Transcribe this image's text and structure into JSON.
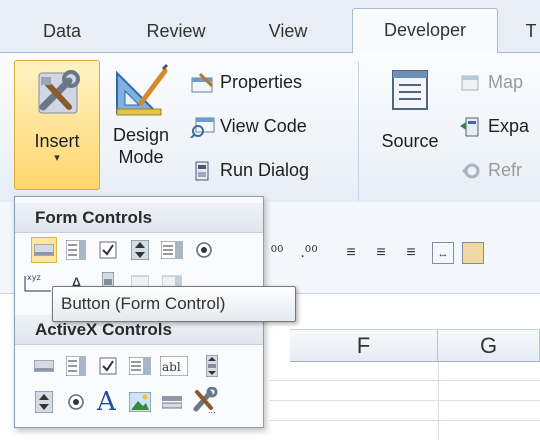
{
  "tabs": [
    {
      "label": "Data"
    },
    {
      "label": "Review"
    },
    {
      "label": "View"
    },
    {
      "label": "Developer"
    },
    {
      "label": "T"
    }
  ],
  "ribbon": {
    "insert": {
      "label": "Insert",
      "arrow": "▾"
    },
    "design_mode": {
      "label": "Design\nMode"
    },
    "properties": {
      "label": "Properties"
    },
    "view_code": {
      "label": "View Code"
    },
    "run_dialog": {
      "label": "Run Dialog"
    },
    "source": {
      "label": "Source"
    },
    "map": {
      "label": "Map"
    },
    "expand": {
      "label": "Expa"
    },
    "refresh": {
      "label": "Refr"
    }
  },
  "dropdown": {
    "form_controls_title": "Form Controls",
    "activex_controls_title": "ActiveX Controls",
    "form_controls": [
      "button-control-icon",
      "combo-box-icon",
      "check-box-icon",
      "spin-button-icon",
      "list-box-icon",
      "option-button-icon",
      "group-box-icon",
      "label-icon",
      "scroll-bar-icon",
      "text-field-icon",
      "combo-list-edit-icon"
    ],
    "activex_controls": [
      "command-button-icon",
      "combo-box-icon",
      "check-box-icon",
      "list-box-icon",
      "text-box-icon",
      "scroll-bar-icon",
      "spin-button-icon",
      "option-button-icon",
      "label-icon",
      "image-icon",
      "toggle-button-icon",
      "more-controls-icon"
    ]
  },
  "tooltip": {
    "text": "Button (Form Control)"
  },
  "columns": [
    {
      "label": "F"
    },
    {
      "label": "G"
    }
  ],
  "colors": {
    "accent_active": "#ffd66e",
    "ribbon_bg": "#eef3f9",
    "tab_strip_bg": "#e8eef6"
  }
}
